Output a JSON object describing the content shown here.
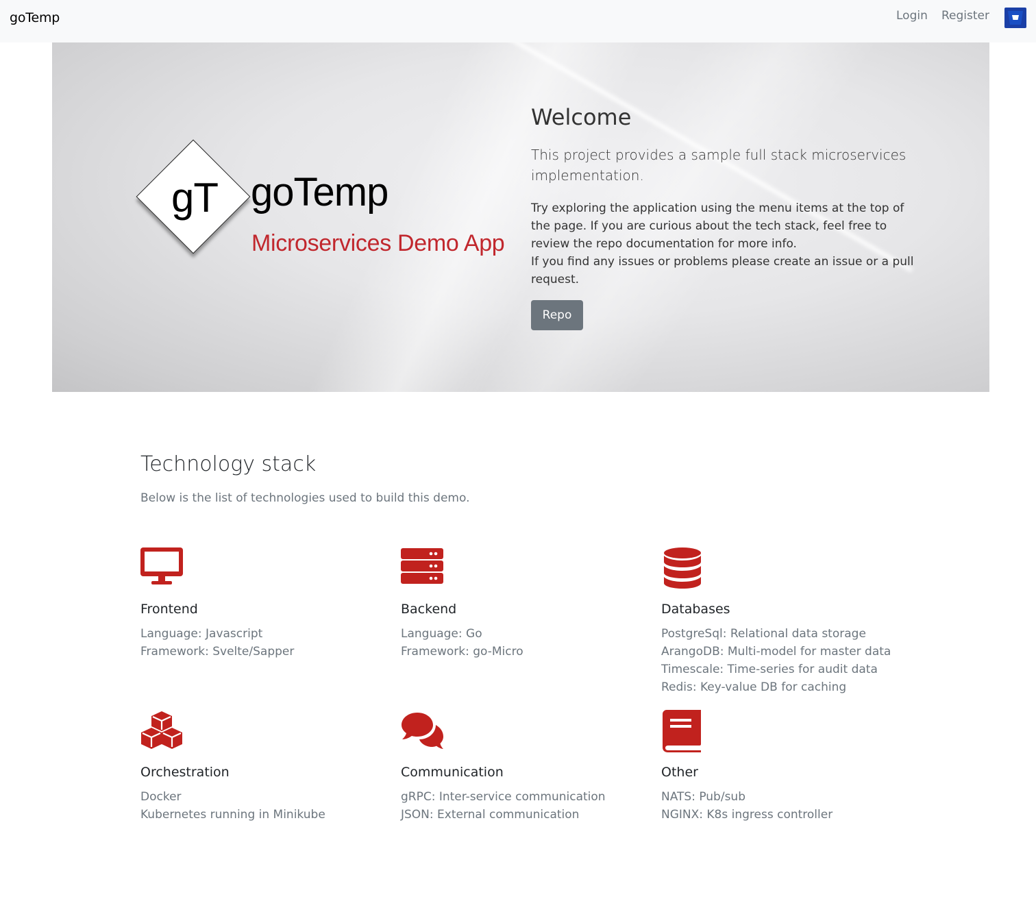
{
  "navbar": {
    "brand": "goTemp",
    "login": "Login",
    "register": "Register",
    "bucket_icon": "bucket-icon",
    "bucket_color": "#1a3fa6"
  },
  "hero": {
    "logo_mark": "gT",
    "logo_name": "goTemp",
    "logo_subtitle": "Microservices Demo App",
    "title": "Welcome",
    "lead": "This project provides a sample full stack microservices implementation.",
    "paragraph1": "Try exploring the application using the menu items at the top of the page. If you are curious about the tech stack, feel free to review the repo documentation for more info.",
    "paragraph2": "If you find any issues or problems please create an issue or a pull request.",
    "button": "Repo"
  },
  "tech": {
    "title": "Technology stack",
    "lead": "Below is the list of technologies used to build this demo.",
    "accent_color": "#c1221e",
    "features": [
      {
        "icon": "desktop-icon",
        "title": "Frontend",
        "items": [
          "Language: Javascript",
          "Framework: Svelte/Sapper"
        ]
      },
      {
        "icon": "server-icon",
        "title": "Backend",
        "items": [
          "Language: Go",
          "Framework: go-Micro"
        ]
      },
      {
        "icon": "database-icon",
        "title": "Databases",
        "items": [
          "PostgreSql: Relational data storage",
          "ArangoDB: Multi-model for master data",
          "Timescale: Time-series for audit data",
          "Redis: Key-value DB for caching"
        ]
      },
      {
        "icon": "cubes-icon",
        "title": "Orchestration",
        "items": [
          "Docker",
          "Kubernetes running in Minikube"
        ]
      },
      {
        "icon": "comments-icon",
        "title": "Communication",
        "items": [
          "gRPC: Inter-service communication",
          "JSON: External communication"
        ]
      },
      {
        "icon": "book-icon",
        "title": "Other",
        "items": [
          "NATS: Pub/sub",
          "NGINX: K8s ingress controller"
        ]
      }
    ]
  }
}
